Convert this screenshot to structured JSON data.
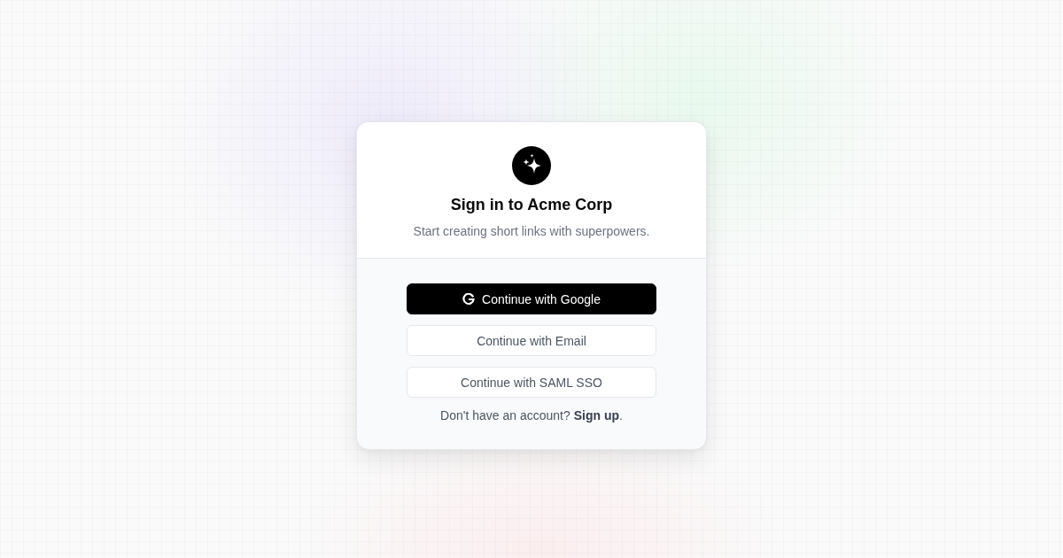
{
  "card": {
    "title": "Sign in to Acme Corp",
    "subtitle": "Start creating short links with superpowers."
  },
  "buttons": [
    {
      "kind": "primary",
      "label": "Continue with Google"
    },
    {
      "kind": "secondary",
      "label": "Continue with Email"
    },
    {
      "kind": "secondary",
      "label": "Continue with SAML SSO"
    }
  ],
  "footer": {
    "text": "Don't have an account?",
    "link": "Sign up",
    "after": "."
  }
}
